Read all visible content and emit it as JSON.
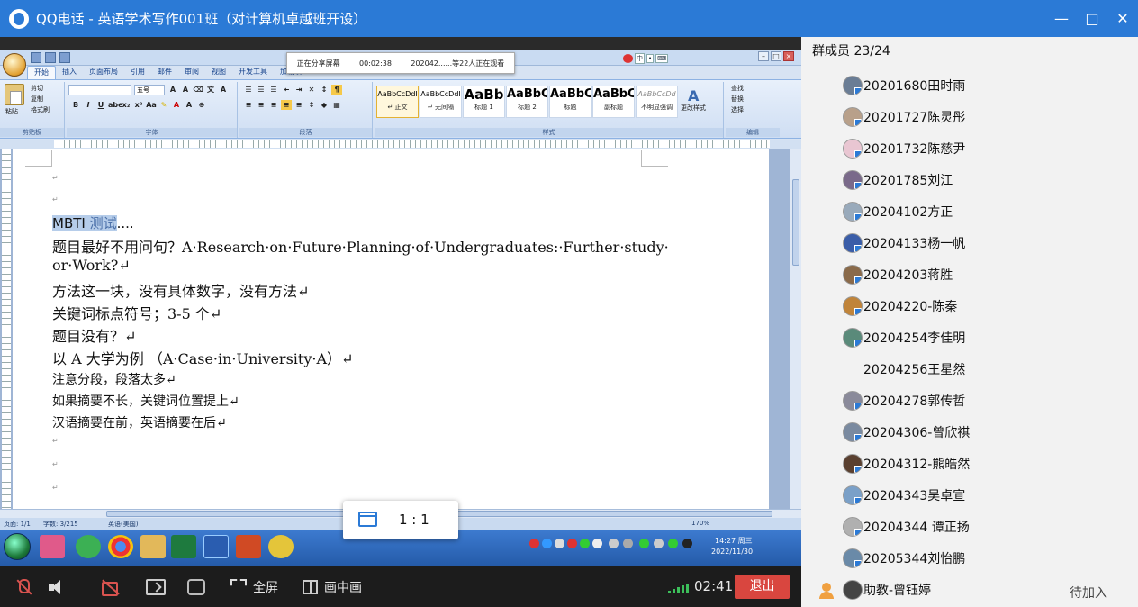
{
  "window": {
    "title": "QQ电话 - 英语学术写作001班（对计算机卓越班开设）",
    "controls": [
      "—",
      "□",
      "✕"
    ]
  },
  "share_bar": {
    "status": "正在分享屏幕",
    "elapsed": "00:02:38",
    "viewers": "202042......等22人正在观看"
  },
  "word": {
    "tabs": [
      "开始",
      "插入",
      "页面布局",
      "引用",
      "邮件",
      "审阅",
      "视图",
      "开发工具",
      "加载项"
    ],
    "clipboard": {
      "paste": "粘贴",
      "cut": "剪切",
      "copy": "复制",
      "format_painter": "格式刷",
      "label": "剪贴板"
    },
    "font": {
      "size": "五号",
      "label": "字体"
    },
    "paragraph": {
      "label": "段落"
    },
    "styles": {
      "items": [
        {
          "sample": "AaBbCcDdI",
          "name": "↵ 正文"
        },
        {
          "sample": "AaBbCcDdI",
          "name": "↵ 无间隔"
        },
        {
          "sample": "AaBb",
          "name": "标题 1"
        },
        {
          "sample": "AaBbC",
          "name": "标题 2"
        },
        {
          "sample": "AaBbC",
          "name": "标题"
        },
        {
          "sample": "AaBbC",
          "name": "副标题"
        },
        {
          "sample": "AaBbCcDd",
          "name": "不明显强调"
        }
      ],
      "change": "更改样式",
      "label": "样式"
    },
    "editing": {
      "find": "查找",
      "replace": "替换",
      "select": "选择",
      "label": "编辑"
    },
    "document": {
      "mbti_selected": "MBTI",
      "mbti_rest": " 测试",
      "mbti_tail": "....",
      "lines": [
        "题目最好不用问句？A·Research·on·Future·Planning·of·Undergraduates:·Further·study·",
        "or·Work?↵",
        "方法这一块，没有具体数字，没有方法↵",
        "关键词标点符号；3-5 个↵",
        "题目没有？↵",
        "以 A 大学为例 （A·Case·in·University·A）↵"
      ],
      "lines_small": [
        "注意分段，段落太多↵",
        "如果摘要不长，关键词位置提上↵",
        "汉语摘要在前，英语摘要在后↵"
      ],
      "para_mark": "↵"
    },
    "statusbar": {
      "page": "页面: 1/1",
      "words": "字数: 3/215",
      "language": "英语(美国)",
      "zoom": "170%"
    },
    "tray": {
      "time": "14:27 周三",
      "date": "2022/11/30"
    }
  },
  "ratio_popup": {
    "label": "1 : 1"
  },
  "controls": {
    "fullscreen": "全屏",
    "pip": "画中画",
    "timer": "02:41",
    "exit": "退出"
  },
  "members": {
    "header": "群成员 23/24",
    "list": [
      {
        "name": "20201680田时雨",
        "avatar": true
      },
      {
        "name": "20201727陈灵彤",
        "avatar": true
      },
      {
        "name": "20201732陈慈尹",
        "avatar": true
      },
      {
        "name": "20201785刘江",
        "avatar": true
      },
      {
        "name": "20204102方正",
        "avatar": true
      },
      {
        "name": "20204133杨一帆",
        "avatar": true
      },
      {
        "name": "20204203蒋胜",
        "avatar": true
      },
      {
        "name": "20204220-陈秦",
        "avatar": true
      },
      {
        "name": "20204254李佳明",
        "avatar": true
      },
      {
        "name": "20204256王星然",
        "avatar": false
      },
      {
        "name": "20204278郭传哲",
        "avatar": true
      },
      {
        "name": "20204306-曾欣祺",
        "avatar": true
      },
      {
        "name": "20204312-熊皓然",
        "avatar": true
      },
      {
        "name": "20204343吴卓宣",
        "avatar": true
      },
      {
        "name": "20204344 谭正扬",
        "avatar": true
      },
      {
        "name": "20205344刘怡鹏",
        "avatar": true
      },
      {
        "name": "助教-曾钰婷",
        "avatar": true
      }
    ],
    "waiting": "待加入"
  }
}
